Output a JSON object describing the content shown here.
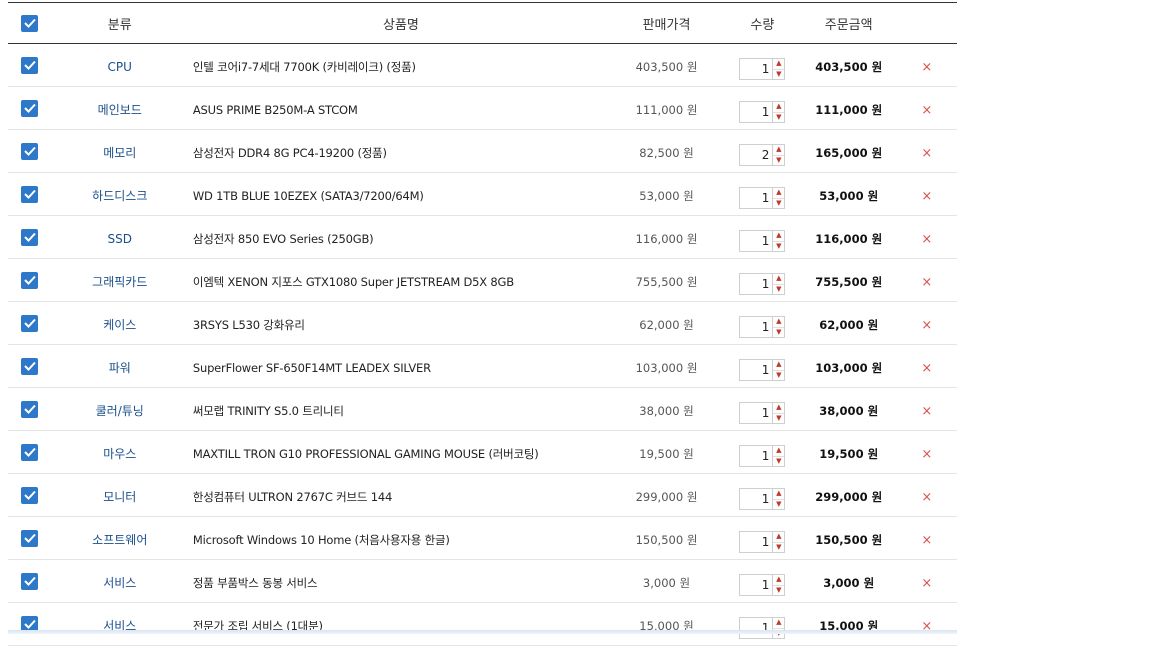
{
  "header": {
    "category": "분류",
    "name": "상품명",
    "price": "판매가격",
    "qty": "수량",
    "total": "주문금액"
  },
  "rows": [
    {
      "category": "CPU",
      "name": "인텔 코어i7-7세대 7700K (카비레이크) (정품)",
      "price": "403,500 원",
      "qty": "1",
      "total": "403,500 원"
    },
    {
      "category": "메인보드",
      "name": "ASUS PRIME B250M-A STCOM",
      "price": "111,000 원",
      "qty": "1",
      "total": "111,000 원"
    },
    {
      "category": "메모리",
      "name": "삼성전자 DDR4 8G PC4-19200 (정품)",
      "price": "82,500 원",
      "qty": "2",
      "total": "165,000 원"
    },
    {
      "category": "하드디스크",
      "name": "WD 1TB BLUE 10EZEX (SATA3/7200/64M)",
      "price": "53,000 원",
      "qty": "1",
      "total": "53,000 원"
    },
    {
      "category": "SSD",
      "name": "삼성전자 850 EVO Series (250GB)",
      "price": "116,000 원",
      "qty": "1",
      "total": "116,000 원"
    },
    {
      "category": "그래픽카드",
      "name": "이엠텍 XENON 지포스 GTX1080 Super JETSTREAM D5X 8GB",
      "price": "755,500 원",
      "qty": "1",
      "total": "755,500 원"
    },
    {
      "category": "케이스",
      "name": "3RSYS L530 강화유리",
      "price": "62,000 원",
      "qty": "1",
      "total": "62,000 원"
    },
    {
      "category": "파워",
      "name": "SuperFlower SF-650F14MT LEADEX SILVER",
      "price": "103,000 원",
      "qty": "1",
      "total": "103,000 원"
    },
    {
      "category": "쿨러/튜닝",
      "name": "써모랩 TRINITY S5.0 트리니티",
      "price": "38,000 원",
      "qty": "1",
      "total": "38,000 원"
    },
    {
      "category": "마우스",
      "name": "MAXTILL TRON G10 PROFESSIONAL GAMING MOUSE (러버코팅)",
      "price": "19,500 원",
      "qty": "1",
      "total": "19,500 원"
    },
    {
      "category": "모니터",
      "name": "한성컴퓨터 ULTRON 2767C 커브드 144",
      "price": "299,000 원",
      "qty": "1",
      "total": "299,000 원"
    },
    {
      "category": "소프트웨어",
      "name": "Microsoft Windows 10 Home (처음사용자용 한글)",
      "price": "150,500 원",
      "qty": "1",
      "total": "150,500 원"
    },
    {
      "category": "서비스",
      "name": "정품 부품박스 동봉 서비스",
      "price": "3,000 원",
      "qty": "1",
      "total": "3,000 원"
    },
    {
      "category": "서비스",
      "name": "전문가 조립 서비스 (1대분)",
      "price": "15,000 원",
      "qty": "1",
      "total": "15,000 원"
    }
  ],
  "icons": {
    "checkbox": "checkbox-checked-icon",
    "delete": "close-icon",
    "delete_glyph": "×",
    "qty_up": "chevron-up-icon",
    "qty_down": "chevron-down-icon"
  },
  "colors": {
    "checkbox": "#2d78c8",
    "category_text": "#1a4f8b",
    "delete": "#d9534f"
  }
}
